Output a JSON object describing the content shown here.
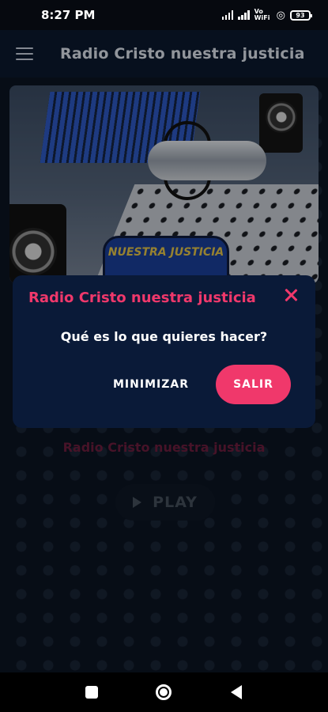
{
  "status_bar": {
    "time": "8:27 PM",
    "network_label": "Vo WiFi",
    "battery": "93"
  },
  "app_bar": {
    "title": "Radio Cristo nuestra justicia",
    "menu_icon": "hamburger-menu-icon"
  },
  "hero": {
    "logo_text": "NUESTRA JUSTICIA"
  },
  "player": {
    "station_name": "Radio Cristo nuestra justicia",
    "play_label": "PLAY",
    "play_icon": "play-icon"
  },
  "dialog": {
    "title": "Radio Cristo nuestra justicia",
    "message": "Qué es lo que quieres hacer?",
    "minimize_label": "MINIMIZAR",
    "exit_label": "SALIR",
    "close_icon": "close-icon",
    "accent_color": "#f0386b",
    "background_color": "#0a1a38"
  },
  "nav_bar": {
    "recents_icon": "square-recents-icon",
    "home_icon": "circle-home-icon",
    "back_icon": "triangle-back-icon"
  }
}
